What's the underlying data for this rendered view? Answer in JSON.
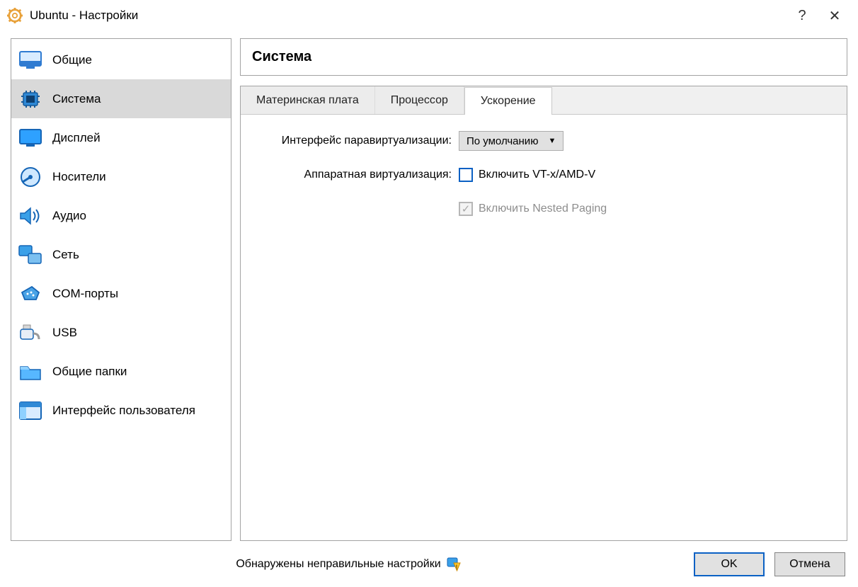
{
  "window": {
    "title": "Ubuntu - Настройки"
  },
  "sidebar": {
    "items": [
      {
        "label": "Общие"
      },
      {
        "label": "Система"
      },
      {
        "label": "Дисплей"
      },
      {
        "label": "Носители"
      },
      {
        "label": "Аудио"
      },
      {
        "label": "Сеть"
      },
      {
        "label": "COM-порты"
      },
      {
        "label": "USB"
      },
      {
        "label": "Общие папки"
      },
      {
        "label": "Интерфейс пользователя"
      }
    ],
    "selected_index": 1
  },
  "main": {
    "heading": "Система",
    "tabs": [
      {
        "label": "Материнская плата"
      },
      {
        "label": "Процессор"
      },
      {
        "label": "Ускорение"
      }
    ],
    "active_tab_index": 2,
    "acceleration": {
      "paravirt_label": "Интерфейс паравиртуализации:",
      "paravirt_value": "По умолчанию",
      "hwvirt_label": "Аппаратная виртуализация:",
      "vt_checkbox_label": "Включить VT-x/AMD-V",
      "vt_checked": false,
      "nested_checkbox_label": "Включить Nested Paging",
      "nested_checked": true,
      "nested_disabled": true
    }
  },
  "footer": {
    "warning_text": "Обнаружены неправильные настройки",
    "ok_label": "OK",
    "cancel_label": "Отмена"
  }
}
